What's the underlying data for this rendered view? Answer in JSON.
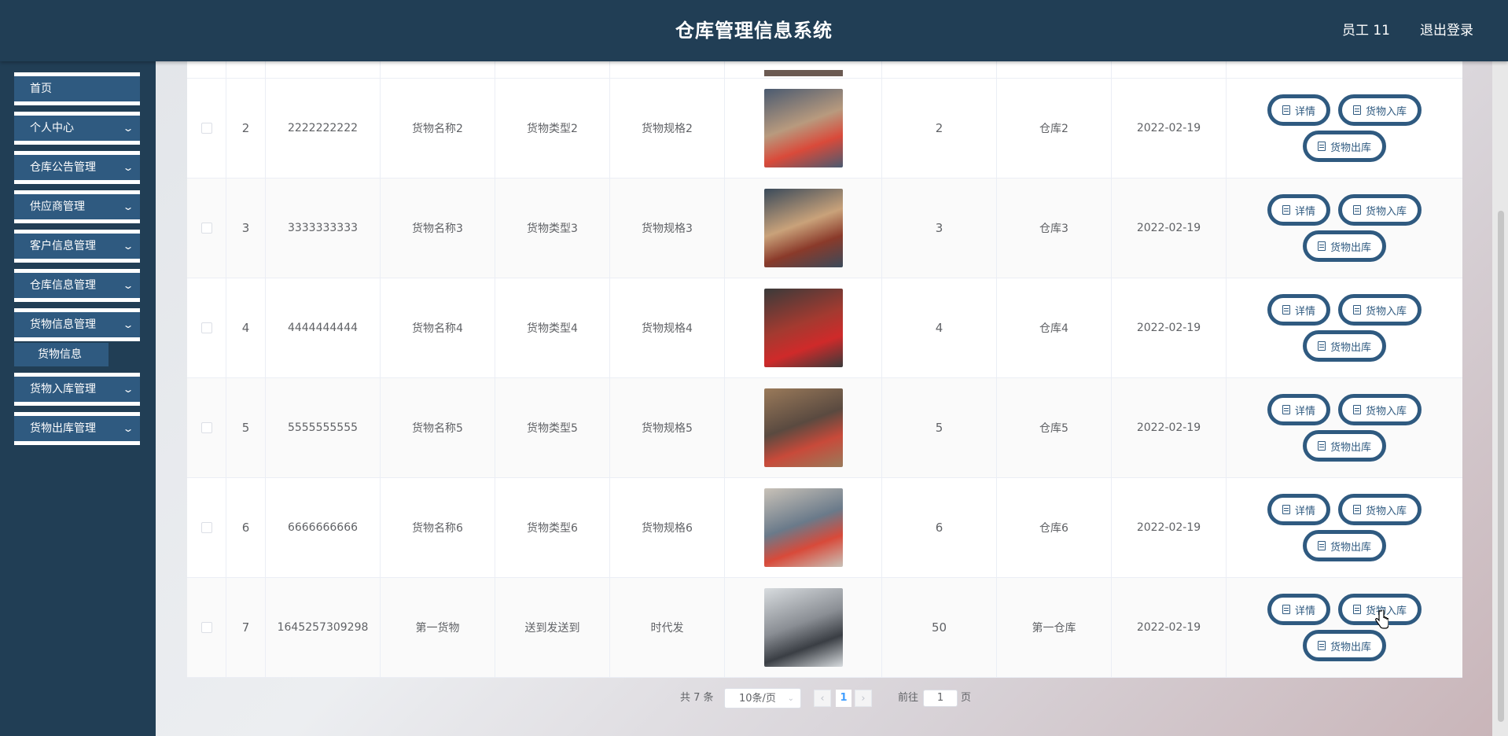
{
  "header": {
    "title": "仓库管理信息系统",
    "user": "员工 11",
    "logout": "退出登录"
  },
  "sidebar": {
    "items": [
      {
        "label": "首页",
        "chevron": false
      },
      {
        "label": "个人中心",
        "chevron": true
      },
      {
        "label": "仓库公告管理",
        "chevron": true
      },
      {
        "label": "供应商管理",
        "chevron": true
      },
      {
        "label": "客户信息管理",
        "chevron": true
      },
      {
        "label": "仓库信息管理",
        "chevron": true
      },
      {
        "label": "货物信息管理",
        "chevron": true
      },
      {
        "label": "货物入库管理",
        "chevron": true
      },
      {
        "label": "货物出库管理",
        "chevron": true
      }
    ],
    "sub_item": "货物信息"
  },
  "table": {
    "rows": [
      {
        "index": "2",
        "code": "2222222222",
        "name": "货物名称2",
        "type": "货物类型2",
        "spec": "货物规格2",
        "qty": "2",
        "warehouse": "仓库2",
        "date": "2022-02-19"
      },
      {
        "index": "3",
        "code": "3333333333",
        "name": "货物名称3",
        "type": "货物类型3",
        "spec": "货物规格3",
        "qty": "3",
        "warehouse": "仓库3",
        "date": "2022-02-19"
      },
      {
        "index": "4",
        "code": "4444444444",
        "name": "货物名称4",
        "type": "货物类型4",
        "spec": "货物规格4",
        "qty": "4",
        "warehouse": "仓库4",
        "date": "2022-02-19"
      },
      {
        "index": "5",
        "code": "5555555555",
        "name": "货物名称5",
        "type": "货物类型5",
        "spec": "货物规格5",
        "qty": "5",
        "warehouse": "仓库5",
        "date": "2022-02-19"
      },
      {
        "index": "6",
        "code": "6666666666",
        "name": "货物名称6",
        "type": "货物类型6",
        "spec": "货物规格6",
        "qty": "6",
        "warehouse": "仓库6",
        "date": "2022-02-19"
      },
      {
        "index": "7",
        "code": "1645257309298",
        "name": "第一货物",
        "type": "送到发送到",
        "spec": "时代发",
        "qty": "50",
        "warehouse": "第一仓库",
        "date": "2022-02-19"
      }
    ],
    "actions": {
      "detail": "详情",
      "inbound": "货物入库",
      "outbound": "货物出库"
    }
  },
  "pagination": {
    "total": "共 7 条",
    "page_size": "10条/页",
    "current_page": "1",
    "goto_label": "前往",
    "goto_value": "1",
    "page_unit": "页"
  },
  "colors": {
    "header_bg": "#213e55",
    "menu_bg": "#2f5a80",
    "button_border": "#2f5a80",
    "active_page": "#409eff"
  }
}
